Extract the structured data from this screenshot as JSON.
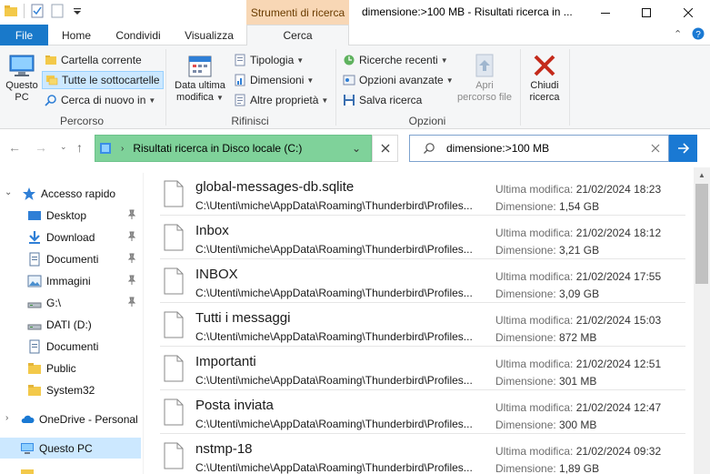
{
  "window": {
    "title": "dimensione:>100 MB - Risultati ricerca in ...",
    "context_tab_header": "Strumenti di ricerca"
  },
  "tabs": [
    {
      "label": "File"
    },
    {
      "label": "Home"
    },
    {
      "label": "Condividi"
    },
    {
      "label": "Visualizza"
    },
    {
      "label": "Cerca"
    }
  ],
  "ribbon": {
    "percorso": {
      "label": "Percorso",
      "questo_pc": "Questo PC",
      "cartella_corrente": "Cartella corrente",
      "tutte_sottocartelle": "Tutte le sottocartelle",
      "cerca_di_nuovo": "Cerca di nuovo in"
    },
    "rifinisci": {
      "label": "Rifinisci",
      "data_ultima_1": "Data ultima",
      "data_ultima_2": "modifica",
      "tipologia": "Tipologia",
      "dimensioni": "Dimensioni",
      "altre_proprieta": "Altre proprietà"
    },
    "opzioni": {
      "label": "Opzioni",
      "ricerche_recenti": "Ricerche recenti",
      "opzioni_avanzate": "Opzioni avanzate",
      "salva_ricerca": "Salva ricerca",
      "apri_percorso_1": "Apri",
      "apri_percorso_2": "percorso file"
    },
    "chiudi": {
      "label_1": "Chiudi",
      "label_2": "ricerca"
    }
  },
  "address": {
    "text": "Risultati ricerca in Disco locale (C:)"
  },
  "search": {
    "query": "dimensione:>100 MB"
  },
  "nav": {
    "items": [
      {
        "label": "Accesso rapido",
        "icon": "star-icon"
      },
      {
        "label": "Desktop",
        "icon": "desktop-icon"
      },
      {
        "label": "Download",
        "icon": "download-icon"
      },
      {
        "label": "Documenti",
        "icon": "documents-icon"
      },
      {
        "label": "Immagini",
        "icon": "images-icon"
      },
      {
        "label": "G:\\",
        "icon": "drive-icon"
      },
      {
        "label": "DATI (D:)",
        "icon": "drive-icon"
      },
      {
        "label": "Documenti",
        "icon": "documents-icon"
      },
      {
        "label": "Public",
        "icon": "folder-icon"
      },
      {
        "label": "System32",
        "icon": "folder-icon"
      },
      {
        "label": "OneDrive - Personal",
        "icon": "cloud-icon"
      },
      {
        "label": "Questo PC",
        "icon": "computer-icon"
      }
    ]
  },
  "results": {
    "modified_label": "Ultima modifica:",
    "size_label": "Dimensione:",
    "items": [
      {
        "name": "global-messages-db.sqlite",
        "path": "C:\\Utenti\\miche\\AppData\\Roaming\\Thunderbird\\Profiles...",
        "modified": "21/02/2024 18:23",
        "size": "1,54 GB"
      },
      {
        "name": "Inbox",
        "path": "C:\\Utenti\\miche\\AppData\\Roaming\\Thunderbird\\Profiles...",
        "modified": "21/02/2024 18:12",
        "size": "3,21 GB"
      },
      {
        "name": "INBOX",
        "path": "C:\\Utenti\\miche\\AppData\\Roaming\\Thunderbird\\Profiles...",
        "modified": "21/02/2024 17:55",
        "size": "3,09 GB"
      },
      {
        "name": "Tutti i messaggi",
        "path": "C:\\Utenti\\miche\\AppData\\Roaming\\Thunderbird\\Profiles...",
        "modified": "21/02/2024 15:03",
        "size": "872 MB"
      },
      {
        "name": "Importanti",
        "path": "C:\\Utenti\\miche\\AppData\\Roaming\\Thunderbird\\Profiles...",
        "modified": "21/02/2024 12:51",
        "size": "301 MB"
      },
      {
        "name": "Posta inviata",
        "path": "C:\\Utenti\\miche\\AppData\\Roaming\\Thunderbird\\Profiles...",
        "modified": "21/02/2024 12:47",
        "size": "300 MB"
      },
      {
        "name": "nstmp-18",
        "path": "C:\\Utenti\\miche\\AppData\\Roaming\\Thunderbird\\Profiles...",
        "modified": "21/02/2024 09:32",
        "size": "1,89 GB"
      }
    ]
  },
  "colors": {
    "accent": "#1979ca",
    "context_tab": "#f8d7b5",
    "address_highlight": "#7fd29a",
    "selection": "#cce8ff"
  }
}
